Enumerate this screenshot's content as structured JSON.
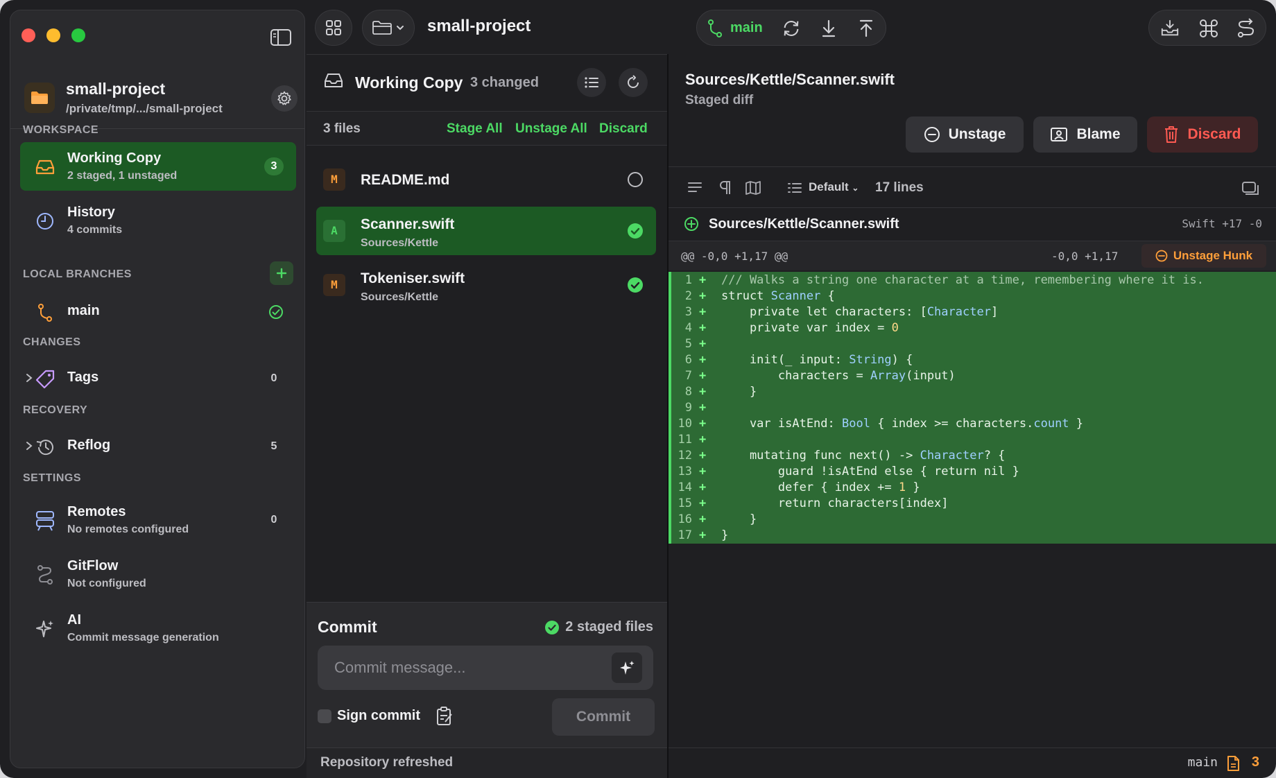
{
  "colors": {
    "accent_green": "#4cd964",
    "active_row": "#1c5a24",
    "modified": "#ff9f3a",
    "danger": "#ff5a52",
    "added_bg": "#2d6a34"
  },
  "toolbar": {
    "project_title": "small-project",
    "branch": "main"
  },
  "sidebar": {
    "repo_name": "small-project",
    "repo_path": "/private/tmp/.../small-project",
    "sections": {
      "workspace": "WORKSPACE",
      "local_branches": "LOCAL BRANCHES",
      "changes": "CHANGES",
      "recovery": "RECOVERY",
      "settings": "SETTINGS"
    },
    "working_copy": {
      "title": "Working Copy",
      "sub": "2 staged, 1 unstaged",
      "count": "3"
    },
    "history": {
      "title": "History",
      "sub": "4 commits"
    },
    "branch": {
      "name": "main"
    },
    "tags": {
      "title": "Tags",
      "count": "0"
    },
    "reflog": {
      "title": "Reflog",
      "count": "5"
    },
    "remotes": {
      "title": "Remotes",
      "sub": "No remotes configured",
      "count": "0"
    },
    "gitflow": {
      "title": "GitFlow",
      "sub": "Not configured"
    },
    "ai": {
      "title": "AI",
      "sub": "Commit message generation"
    }
  },
  "middle": {
    "title": "Working Copy",
    "changed": "3 changed",
    "files_count": "3 files",
    "stage_all": "Stage All",
    "unstage_all": "Unstage All",
    "discard": "Discard",
    "files": [
      {
        "badge": "M",
        "name": "README.md",
        "path": "",
        "staged": false
      },
      {
        "badge": "A",
        "name": "Scanner.swift",
        "path": "Sources/Kettle",
        "staged": true
      },
      {
        "badge": "M",
        "name": "Tokeniser.swift",
        "path": "Sources/Kettle",
        "staged": true
      }
    ],
    "commit": {
      "title": "Commit",
      "staged_files": "2 staged files",
      "placeholder": "Commit message...",
      "sign_label": "Sign commit",
      "button": "Commit"
    },
    "status": "Repository refreshed"
  },
  "diff": {
    "path": "Sources/Kettle/Scanner.swift",
    "subtitle": "Staged diff",
    "unstage": "Unstage",
    "blame": "Blame",
    "discard": "Discard",
    "mode": "Default",
    "lines": "17 lines",
    "file_name": "Sources/Kettle/Scanner.swift",
    "file_meta": "Swift +17  -0",
    "hunk_header": "@@ -0,0 +1,17 @@",
    "hunk_range": "-0,0  +1,17",
    "unstage_hunk": "Unstage Hunk",
    "code": [
      "/// Walks a string one character at a time, remembering where it is.",
      "struct Scanner {",
      "    private let characters: [Character]",
      "    private var index = 0",
      "",
      "    init(_ input: String) {",
      "        characters = Array(input)",
      "    }",
      "",
      "    var isAtEnd: Bool { index >= characters.count }",
      "",
      "    mutating func next() -> Character? {",
      "        guard !isAtEnd else { return nil }",
      "        defer { index += 1 }",
      "        return characters[index]",
      "    }",
      "}"
    ]
  },
  "status_right": {
    "branch": "main",
    "count": "3"
  }
}
